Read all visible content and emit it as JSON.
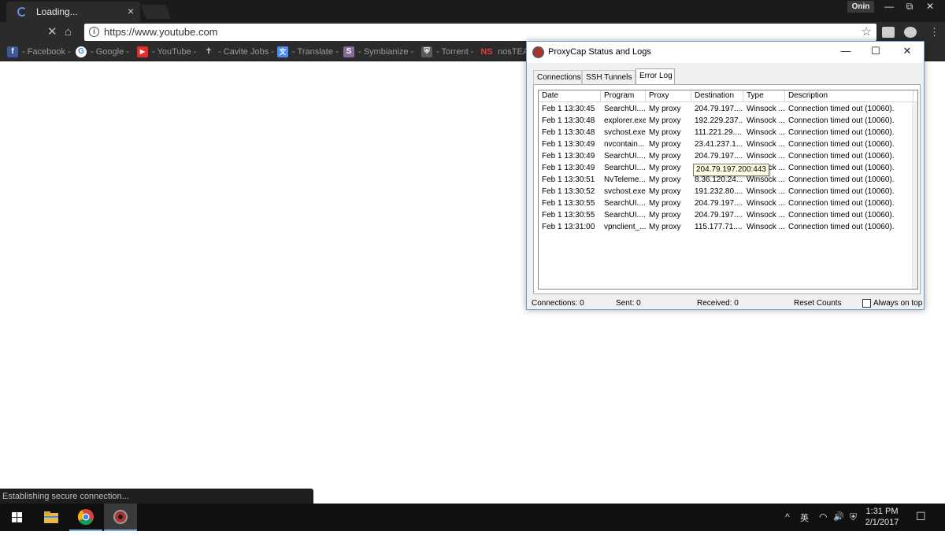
{
  "browser": {
    "tab_title": "Loading...",
    "tab_close": "×",
    "profile_name": "Onin",
    "url": "https://www.youtube.com",
    "status_bubble": "Establishing secure connection...",
    "bookmarks": [
      {
        "label": "- Facebook -",
        "icon": "facebook-icon",
        "color": "#3b5998",
        "glyph": "f"
      },
      {
        "label": "- Google -",
        "icon": "google-icon",
        "color": "#ffffff",
        "glyph": "G"
      },
      {
        "label": "- YouTube -",
        "icon": "youtube-icon",
        "color": "#e52d27",
        "glyph": "▶"
      },
      {
        "label": "- Cavite Jobs -",
        "icon": "cross-icon",
        "color": "#2b2b2b",
        "glyph": "✝"
      },
      {
        "label": "- Translate -",
        "icon": "translate-icon",
        "color": "#4a8af4",
        "glyph": "文"
      },
      {
        "label": "- Symbianize -",
        "icon": "symbianize-icon",
        "color": "#8a6a9a",
        "glyph": "S"
      },
      {
        "label": "- Torrent -",
        "icon": "shield-icon",
        "color": "#5a5a5a",
        "glyph": "⛨"
      },
      {
        "label": "nosTEAM",
        "icon": "nosteam-icon",
        "color": "#2b2b2b",
        "glyph": "NS"
      }
    ]
  },
  "dialog": {
    "title": "ProxyCap Status and Logs",
    "controls": {
      "minimize": "—",
      "maximize": "☐",
      "close": "✕"
    },
    "tabs": [
      {
        "label": "Connections",
        "selected": false
      },
      {
        "label": "SSH Tunnels",
        "selected": false
      },
      {
        "label": "Error Log",
        "selected": true
      }
    ],
    "columns": [
      "Date",
      "Program",
      "Proxy",
      "Destination",
      "Type",
      "Description"
    ],
    "rows": [
      [
        "Feb 1 13:30:45",
        "SearchUI....",
        "My proxy",
        "204.79.197....",
        "Winsock ...",
        "Connection timed out (10060)."
      ],
      [
        "Feb 1 13:30:48",
        "explorer.exe",
        "My proxy",
        "192.229.237....",
        "Winsock ...",
        "Connection timed out (10060)."
      ],
      [
        "Feb 1 13:30:48",
        "svchost.exe",
        "My proxy",
        "111.221.29....",
        "Winsock ...",
        "Connection timed out (10060)."
      ],
      [
        "Feb 1 13:30:49",
        "nvcontain...",
        "My proxy",
        "23.41.237.1...",
        "Winsock ...",
        "Connection timed out (10060)."
      ],
      [
        "Feb 1 13:30:49",
        "SearchUI....",
        "My proxy",
        "204.79.197....",
        "Winsock ...",
        "Connection timed out (10060)."
      ],
      [
        "Feb 1 13:30:49",
        "SearchUI....",
        "My proxy",
        "20",
        "Winsock ...",
        "Connection timed out (10060)."
      ],
      [
        "Feb 1 13:30:51",
        "NvTeleme...",
        "My proxy",
        "8.36.120.24...",
        "Winsock ...",
        "Connection timed out (10060)."
      ],
      [
        "Feb 1 13:30:52",
        "svchost.exe",
        "My proxy",
        "191.232.80....",
        "Winsock ...",
        "Connection timed out (10060)."
      ],
      [
        "Feb 1 13:30:55",
        "SearchUI....",
        "My proxy",
        "204.79.197....",
        "Winsock ...",
        "Connection timed out (10060)."
      ],
      [
        "Feb 1 13:30:55",
        "SearchUI....",
        "My proxy",
        "204.79.197....",
        "Winsock ...",
        "Connection timed out (10060)."
      ],
      [
        "Feb 1 13:31:00",
        "vpnclient_...",
        "My proxy",
        "115.177.71....",
        "Winsock ...",
        "Connection timed out (10060)."
      ]
    ],
    "tooltip": "204.79.197.200:443",
    "status": {
      "connections": "Connections: 0",
      "sent": "Sent:  0",
      "received": "Received:  0",
      "reset": "Reset Counts",
      "always_on_top": "Always on top"
    }
  },
  "taskbar": {
    "time": "1:31 PM",
    "date": "2/1/2017",
    "tray": {
      "chevron": "^",
      "ime": "英",
      "wifi": "◠",
      "volume": "🔊",
      "notifications": "☐"
    }
  }
}
